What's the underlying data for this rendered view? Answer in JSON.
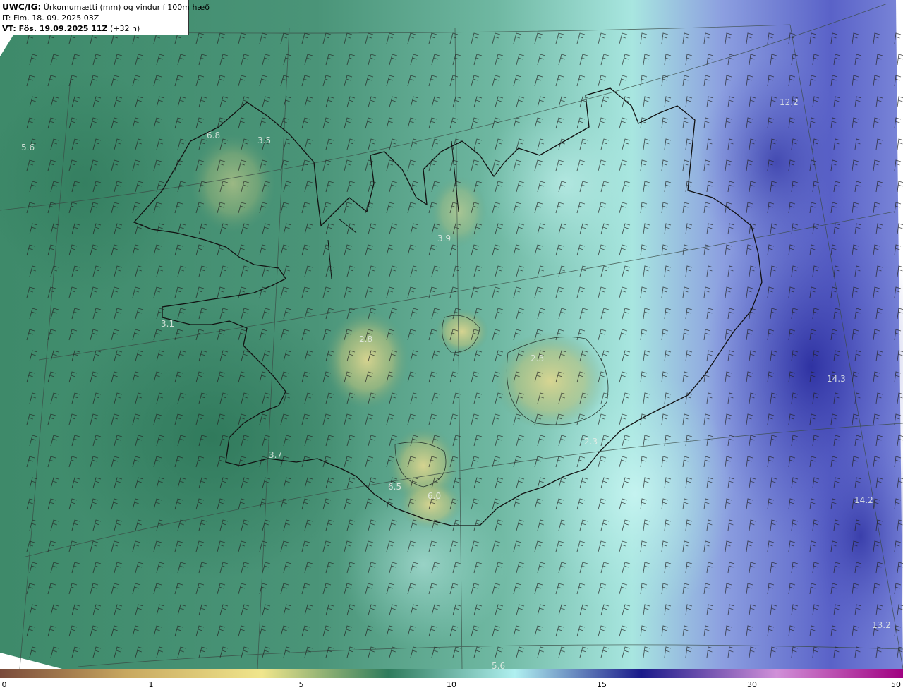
{
  "header": {
    "title_code": "UWC/IG:",
    "title_text": "Úrkomumætti (mm) og vindur í 100m hæð",
    "issue_time": "IT: Fim. 18. 09. 2025 03Z",
    "valid_code": "VT: Fös. 19.09.2025 11Z",
    "valid_offset": "(+32 h)"
  },
  "colorbar": {
    "labels": [
      "0",
      "1",
      "5",
      "10",
      "15",
      "30",
      "50"
    ],
    "colors": [
      "#7a4a3a",
      "#c8a860",
      "#f0e68c",
      "#2e7b5c",
      "#b0f0f0",
      "#1a1a8a",
      "#d090d8",
      "#a00080"
    ]
  },
  "map_labels": [
    {
      "text": "5.6"
    },
    {
      "text": "6.8"
    },
    {
      "text": "3.5"
    },
    {
      "text": "3.9"
    },
    {
      "text": "3.1"
    },
    {
      "text": "2.8"
    },
    {
      "text": "2.3"
    },
    {
      "text": "2.3"
    },
    {
      "text": "3.7"
    },
    {
      "text": "6.5"
    },
    {
      "text": "6.0"
    },
    {
      "text": "12.2"
    },
    {
      "text": "14.3"
    },
    {
      "text": "14.2"
    },
    {
      "text": "13.2"
    },
    {
      "text": "5.6"
    }
  ],
  "colors": {
    "dry": "#d8d48c",
    "moderate": "#3f8a6c",
    "wet": "#b8f0ee",
    "heavy": "#2a2ea0"
  }
}
